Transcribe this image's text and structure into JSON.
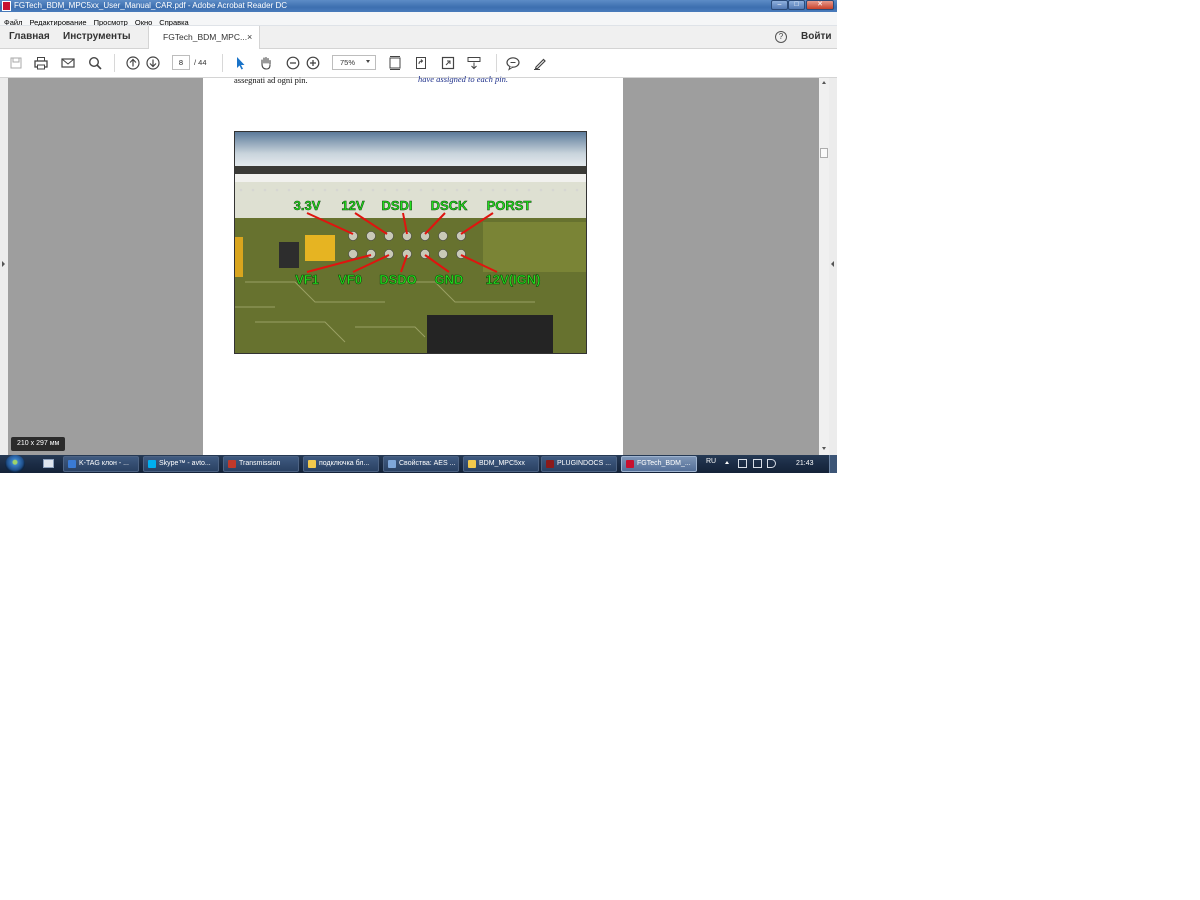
{
  "window": {
    "title": "FGTech_BDM_MPC5xx_User_Manual_CAR.pdf - Adobe Acrobat Reader DC",
    "min_label": "–",
    "max_label": "□",
    "close_label": "✕"
  },
  "menu": [
    "Файл",
    "Редактирование",
    "Просмотр",
    "Окно",
    "Справка"
  ],
  "tabs": {
    "home": "Главная",
    "tools": "Инструменты",
    "document": "FGTech_BDM_MPC...",
    "close": "×",
    "help": "?",
    "signin": "Войти"
  },
  "toolbar": {
    "page_current": "8",
    "page_total": "/ 44",
    "zoom": "75%"
  },
  "document": {
    "text_it": "assegnati ad ogni pin.",
    "text_en": "have assigned to each pin.",
    "pin_labels_top": [
      "3.3V",
      "12V",
      "DSDI",
      "DSCK",
      "PORST"
    ],
    "pin_labels_bottom": [
      "VF1",
      "VF0",
      "DSDO",
      "GND",
      "12V(IGN)"
    ],
    "page_size": "210 x 297 мм"
  },
  "taskbar": {
    "items": [
      {
        "label": "K-TAG клон - ...",
        "icon_color": "#3a7bd5",
        "active": false
      },
      {
        "label": "Skype™ - avto...",
        "icon_color": "#00aff0",
        "active": false
      },
      {
        "label": "Transmission",
        "icon_color": "#c0392b",
        "active": false
      },
      {
        "label": "подключка бл...",
        "icon_color": "#f2c94c",
        "active": false
      },
      {
        "label": "Свойства: AES ...",
        "icon_color": "#7fa7d9",
        "active": false
      },
      {
        "label": "BDM_MPC5xx",
        "icon_color": "#f2c94c",
        "active": false
      },
      {
        "label": "PLUGINDOCS ...",
        "icon_color": "#8b1a1a",
        "active": false
      },
      {
        "label": "FGTech_BDM_...",
        "icon_color": "#c8102e",
        "active": true
      }
    ],
    "language": "RU",
    "clock": "21:43"
  }
}
